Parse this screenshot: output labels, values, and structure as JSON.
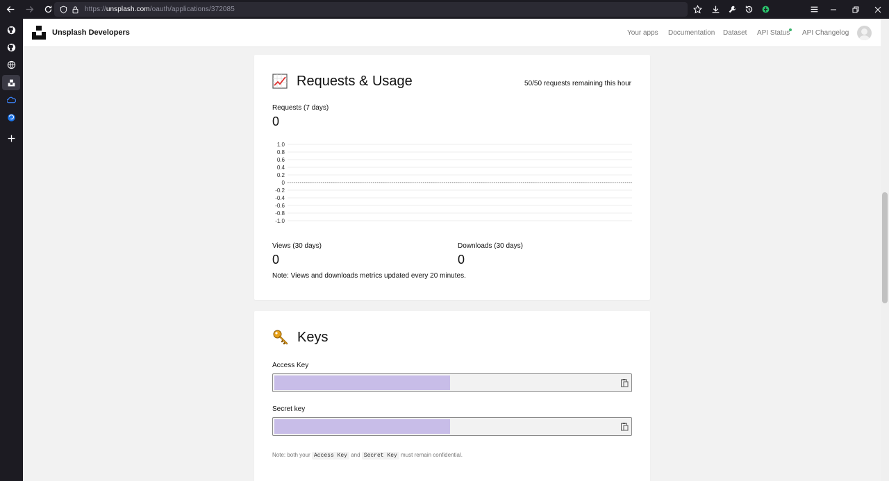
{
  "browser": {
    "url_prefix": "https://",
    "url_host": "unsplash.com",
    "url_path": "/oauth/applications/372085"
  },
  "sidebar": {
    "items": [
      {
        "name": "github-icon"
      },
      {
        "name": "github-icon"
      },
      {
        "name": "globe-icon"
      },
      {
        "name": "unsplash-icon"
      },
      {
        "name": "extension-icon"
      },
      {
        "name": "firefox-icon"
      },
      {
        "name": "add-icon"
      }
    ]
  },
  "header": {
    "brand": "Unsplash Developers",
    "nav": {
      "your_apps": "Your apps",
      "documentation": "Documentation",
      "dataset": "Dataset",
      "api_status": "API Status",
      "api_changelog": "API Changelog"
    }
  },
  "usage": {
    "title": "Requests & Usage",
    "remaining": "50/50 requests remaining this hour",
    "requests_label": "Requests (7 days)",
    "requests_value": "0",
    "views_label": "Views (30 days)",
    "views_value": "0",
    "downloads_label": "Downloads (30 days)",
    "downloads_value": "0",
    "note": "Note: Views and downloads metrics updated every 20 minutes."
  },
  "chart_data": {
    "type": "line",
    "ylim": [
      -1.0,
      1.0
    ],
    "yticks": [
      "1.0",
      "0.8",
      "0.6",
      "0.4",
      "0.2",
      "0",
      "-0.2",
      "-0.4",
      "-0.6",
      "-0.8",
      "-1.0"
    ],
    "series": [
      {
        "values": [
          0,
          0,
          0,
          0,
          0,
          0,
          0
        ]
      }
    ],
    "grid": true
  },
  "keys": {
    "title": "Keys",
    "access_label": "Access Key",
    "secret_label": "Secret key",
    "note_prefix": "Note: both your",
    "note_access": "Access Key",
    "note_and": "and",
    "note_secret": "Secret Key",
    "note_suffix": "must remain confidential."
  },
  "colors": {
    "status_dot": "#3cb46e",
    "key_mask": "#c8bde8"
  }
}
